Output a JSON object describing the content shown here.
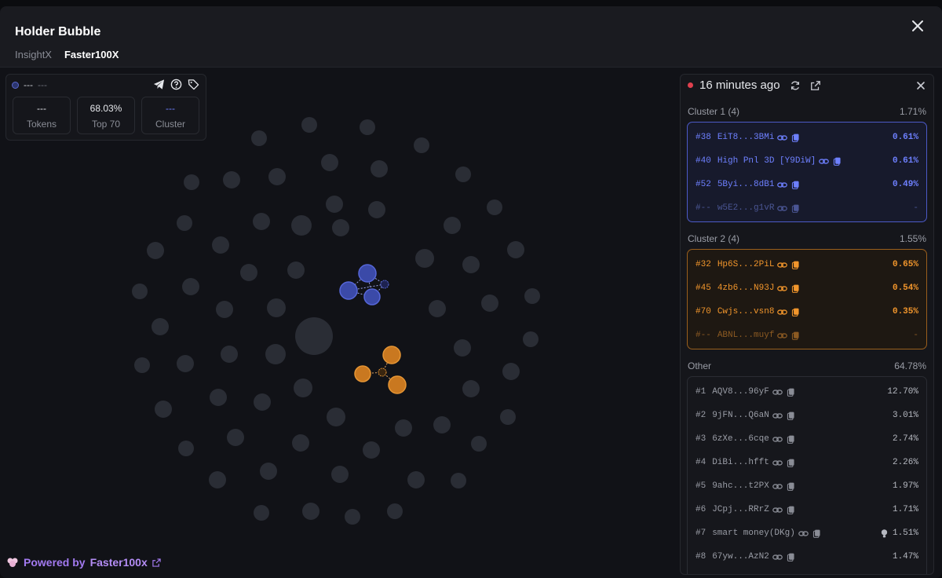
{
  "header": {
    "title": "Holder Bubble",
    "tabs": [
      {
        "label": "InsightX",
        "active": false
      },
      {
        "label": "Faster100X",
        "active": true
      }
    ]
  },
  "stats": {
    "token_name": "---",
    "token_symbol": "---",
    "items": [
      {
        "value": "---",
        "label": "Tokens"
      },
      {
        "value": "68.03%",
        "label": "Top 70"
      },
      {
        "value": "---",
        "label": "Cluster"
      }
    ]
  },
  "footer": {
    "powered_prefix": "Powered by",
    "brand": "Faster100x"
  },
  "panel": {
    "updated": "16 minutes ago",
    "clusters": [
      {
        "label": "Cluster 1 (4)",
        "pct": "1.71%",
        "color": "#5a6cf0",
        "rows": [
          {
            "rank": "#38",
            "addr": "EiT8...3BMi",
            "pct": "0.61%",
            "dim": false
          },
          {
            "rank": "#40",
            "addr": "High Pnl 3D [Y9DiW]",
            "pct": "0.61%",
            "dim": false
          },
          {
            "rank": "#52",
            "addr": "5Byi...8dB1",
            "pct": "0.49%",
            "dim": false
          },
          {
            "rank": "#--",
            "addr": "w5E2...g1vR",
            "pct": "-",
            "dim": true
          }
        ]
      },
      {
        "label": "Cluster 2 (4)",
        "pct": "1.55%",
        "color": "#f2962c",
        "rows": [
          {
            "rank": "#32",
            "addr": "Hp6S...2PiL",
            "pct": "0.65%",
            "dim": false
          },
          {
            "rank": "#45",
            "addr": "4zb6...N93J",
            "pct": "0.54%",
            "dim": false
          },
          {
            "rank": "#70",
            "addr": "Cwjs...vsn8",
            "pct": "0.35%",
            "dim": false
          },
          {
            "rank": "#--",
            "addr": "ABNL...muyf",
            "pct": "-",
            "dim": true
          }
        ]
      }
    ],
    "other": {
      "label": "Other",
      "pct": "64.78%",
      "rows": [
        {
          "rank": "#1",
          "addr": "AQV8...96yF",
          "pct": "12.70%"
        },
        {
          "rank": "#2",
          "addr": "9jFN...Q6aN",
          "pct": "3.01%"
        },
        {
          "rank": "#3",
          "addr": "6zXe...6cqe",
          "pct": "2.74%"
        },
        {
          "rank": "#4",
          "addr": "DiBi...hfft",
          "pct": "2.26%"
        },
        {
          "rank": "#5",
          "addr": "9ahc...t2PX",
          "pct": "1.97%"
        },
        {
          "rank": "#6",
          "addr": "JCpj...RRrZ",
          "pct": "1.71%"
        },
        {
          "rank": "#7",
          "addr": "smart money(DKg)",
          "pct": "1.51%",
          "bulb": true
        },
        {
          "rank": "#8",
          "addr": "67yw...AzN2",
          "pct": "1.47%"
        }
      ]
    }
  },
  "icons": {
    "close": "close-icon",
    "telegram": "telegram-icon",
    "help": "help-icon",
    "tag": "tag-icon",
    "refresh": "refresh-icon",
    "external": "external-link-icon",
    "link": "link-icon",
    "copy": "copy-icon",
    "bulb": "lightbulb-icon"
  },
  "colors": {
    "background": "#111217",
    "blue_cluster": "#4b5bd4",
    "orange_cluster": "#e08a2a",
    "bubble": "#2a2d35",
    "brand": "#a27af0"
  }
}
